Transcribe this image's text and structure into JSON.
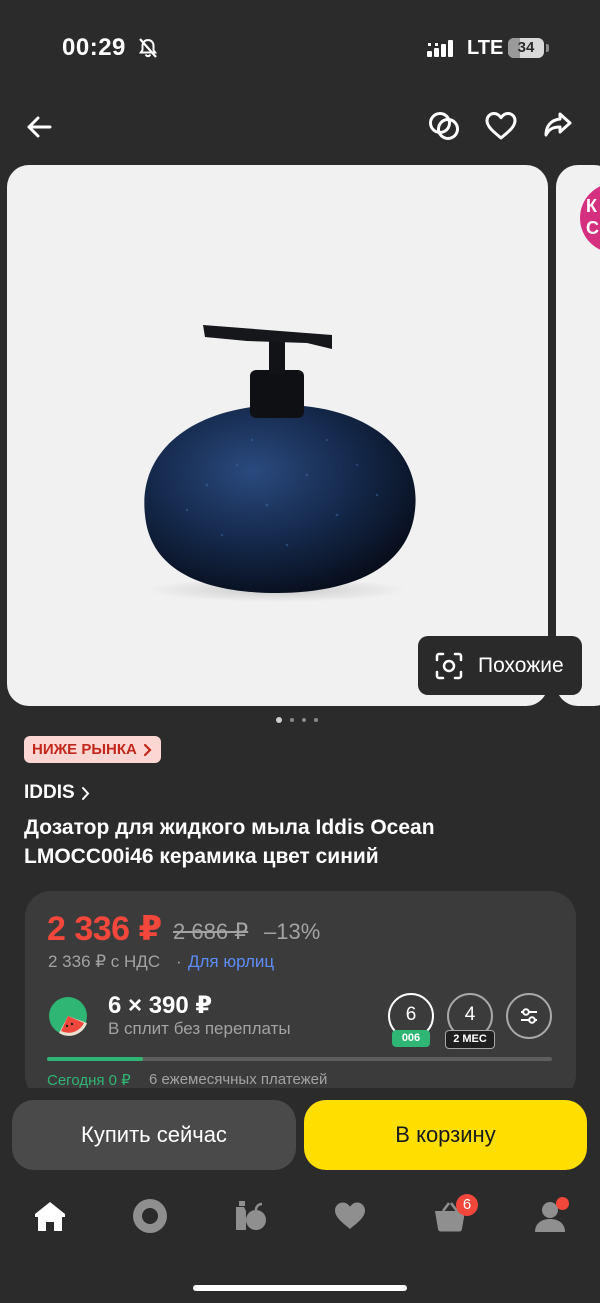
{
  "status_bar": {
    "time": "00:29",
    "network": "LTE",
    "battery": "34",
    "battery_level": 0.34
  },
  "header": {
    "back_icon": "arrow-left-icon",
    "compare_icon": "compare-icon",
    "favorite_icon": "heart-icon",
    "share_icon": "share-icon"
  },
  "gallery": {
    "similar_label": "Похожие",
    "pages": 4,
    "active_page": 1,
    "next_card_promo": "К\nС",
    "product_image": "blue ceramic soap dispenser"
  },
  "badge": {
    "label": "НИЖЕ РЫНКА",
    "bg": "#fbd6d2",
    "color": "#c4271b"
  },
  "product": {
    "brand": "IDDIS",
    "title": "Дозатор для жидкого мыла Iddis Ocean LMOCC00i46 керамика цвет синий"
  },
  "price": {
    "current": "2 336 ₽",
    "old": "2 686 ₽",
    "discount": "–13%",
    "vat": "2 336 ₽ с НДС",
    "separator": "·",
    "legal_link": "Для юрлиц",
    "accent": "#f2473a"
  },
  "split": {
    "amount": "6 × 390 ₽",
    "subtitle": "В сплит без переплаты",
    "terms": [
      {
        "value": "6",
        "tag": "006",
        "selected": true
      },
      {
        "value": "4",
        "tag": "2 МЕС",
        "selected": false
      }
    ],
    "settings_icon": "sliders-icon",
    "today": "Сегодня 0 ₽",
    "payments": "6 ежемесячных платежей",
    "progress": 0.19
  },
  "actions": {
    "buy_now": "Купить сейчас",
    "add_to_cart": "В корзину",
    "cart_color": "#ffde00"
  },
  "bottom_nav": {
    "items": [
      {
        "icon": "home-icon"
      },
      {
        "icon": "alice-icon"
      },
      {
        "icon": "categories-icon"
      },
      {
        "icon": "favorites-icon"
      },
      {
        "icon": "cart-icon",
        "badge": "6"
      },
      {
        "icon": "profile-icon"
      }
    ]
  }
}
